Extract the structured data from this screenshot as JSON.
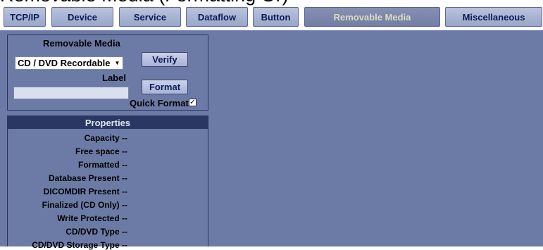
{
  "caption": "Removable Media (Formatting Or)",
  "tabs": [
    {
      "label": "TCP/IP"
    },
    {
      "label": "Device"
    },
    {
      "label": "Service"
    },
    {
      "label": "Dataflow"
    },
    {
      "label": "Button"
    },
    {
      "label": "Removable Media",
      "active": true
    },
    {
      "label": "Miscellaneous"
    }
  ],
  "media": {
    "title": "Removable Media",
    "selected": "CD / DVD Recordable",
    "label_caption": "Label",
    "label_value": "",
    "verify": "Verify",
    "format": "Format",
    "quick_format": "Quick Format",
    "quick_format_checked": true
  },
  "properties": {
    "title": "Properties",
    "rows": [
      {
        "label": "Capacity",
        "value": "--"
      },
      {
        "label": "Free space",
        "value": "--"
      },
      {
        "label": "Formatted",
        "value": "--"
      },
      {
        "label": "Database Present",
        "value": "--"
      },
      {
        "label": "DICOMDIR Present",
        "value": "--"
      },
      {
        "label": "Finalized (CD Only)",
        "value": "--"
      },
      {
        "label": "Write Protected",
        "value": "--"
      },
      {
        "label": "CD/DVD Type",
        "value": "--"
      },
      {
        "label": "CD/DVD Storage Type",
        "value": "--"
      }
    ]
  },
  "colors": {
    "panel": "#6c7aa6",
    "header": "#2a3763",
    "tab_text": "#0b1c55",
    "active_tab_text": "#d9dcc0"
  }
}
